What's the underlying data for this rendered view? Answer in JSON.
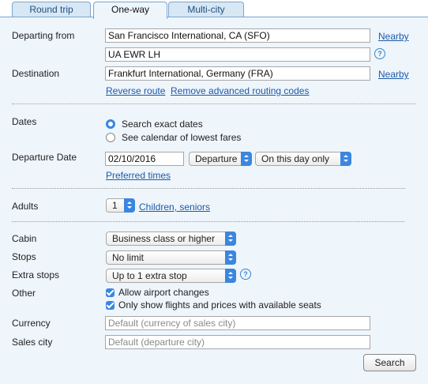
{
  "tabs": {
    "round_trip": "Round trip",
    "one_way": "One-way",
    "multi_city": "Multi-city"
  },
  "route": {
    "departing_label": "Departing from",
    "departing_value": "San Francisco International, CA (SFO)",
    "routing_value": "UA EWR LH",
    "destination_label": "Destination",
    "destination_value": "Frankfurt International, Germany (FRA)",
    "nearby": "Nearby",
    "reverse_route": "Reverse route",
    "remove_routing": "Remove advanced routing codes",
    "help": "?"
  },
  "dates": {
    "label": "Dates",
    "opt_exact": "Search exact dates",
    "opt_calendar": "See calendar of lowest fares",
    "exact_selected": true,
    "departure_label": "Departure Date",
    "departure_value": "02/10/2016",
    "time_type": "Departure",
    "day_option": "On this day only",
    "preferred_times": "Preferred times"
  },
  "passengers": {
    "adults_label": "Adults",
    "adults_value": "1",
    "children_link": "Children, seniors"
  },
  "options": {
    "cabin_label": "Cabin",
    "cabin_value": "Business class or higher",
    "stops_label": "Stops",
    "stops_value": "No limit",
    "extra_stops_label": "Extra stops",
    "extra_stops_value": "Up to 1 extra stop",
    "other_label": "Other",
    "allow_changes": "Allow airport changes",
    "only_available": "Only show flights and prices with available seats",
    "currency_label": "Currency",
    "currency_placeholder": "Default (currency of sales city)",
    "sales_city_label": "Sales city",
    "sales_city_placeholder": "Default (departure city)"
  },
  "search_button": "Search",
  "colors": {
    "panel_bg": "#eef5fb",
    "accent": "#3a86e0",
    "link": "#1d5aa8"
  }
}
